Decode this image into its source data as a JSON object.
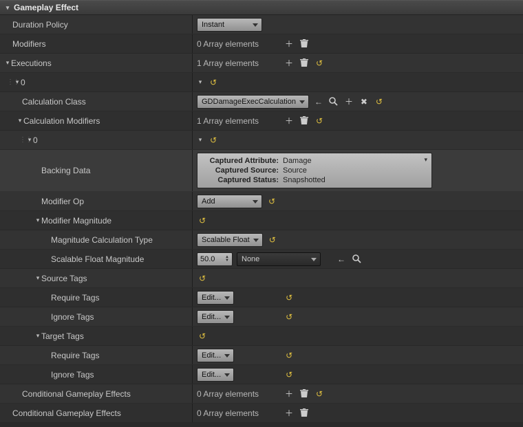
{
  "section": {
    "title": "Gameplay Effect"
  },
  "durationPolicy": {
    "label": "Duration Policy",
    "value": "Instant"
  },
  "modifiers": {
    "label": "Modifiers",
    "arrayText": "0 Array elements"
  },
  "executions": {
    "label": "Executions",
    "arrayText": "1 Array elements",
    "index0": {
      "label": "0",
      "calcClass": {
        "label": "Calculation Class",
        "value": "GDDamageExecCalculation"
      },
      "calcModifiers": {
        "label": "Calculation Modifiers",
        "arrayText": "1 Array elements",
        "index0": {
          "label": "0",
          "backingData": {
            "label": "Backing Data",
            "capturedAttributeK": "Captured Attribute:",
            "capturedAttributeV": "Damage",
            "capturedSourceK": "Captured Source:",
            "capturedSourceV": "Source",
            "capturedStatusK": "Captured Status:",
            "capturedStatusV": "Snapshotted"
          },
          "modifierOp": {
            "label": "Modifier Op",
            "value": "Add"
          },
          "modifierMagnitude": {
            "label": "Modifier Magnitude",
            "magCalcType": {
              "label": "Magnitude Calculation Type",
              "value": "Scalable Float"
            },
            "scalableFloat": {
              "label": "Scalable Float Magnitude",
              "value": "50.0",
              "curve": "None"
            }
          },
          "sourceTags": {
            "label": "Source Tags",
            "requireTags": {
              "label": "Require Tags",
              "value": "Edit..."
            },
            "ignoreTags": {
              "label": "Ignore Tags",
              "value": "Edit..."
            }
          },
          "targetTags": {
            "label": "Target Tags",
            "requireTags": {
              "label": "Require Tags",
              "value": "Edit..."
            },
            "ignoreTags": {
              "label": "Ignore Tags",
              "value": "Edit..."
            }
          }
        }
      },
      "conditionalGE": {
        "label": "Conditional Gameplay Effects",
        "arrayText": "0 Array elements"
      }
    }
  },
  "conditionalGEOuter": {
    "label": "Conditional Gameplay Effects",
    "arrayText": "0 Array elements"
  }
}
